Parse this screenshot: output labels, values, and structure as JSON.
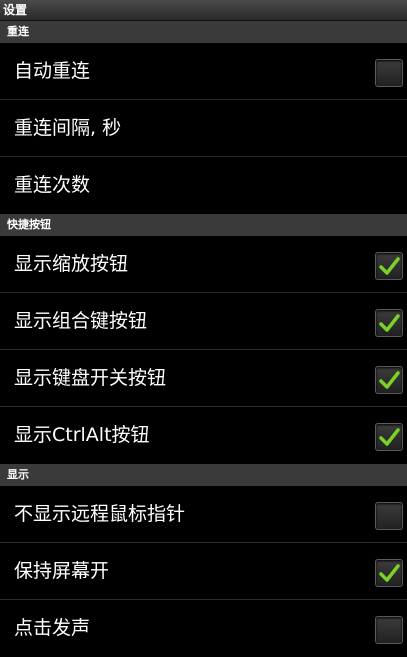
{
  "title": "设置",
  "sections": [
    {
      "header": "重连",
      "items": [
        {
          "label": "自动重连",
          "checkbox": true,
          "checked": false
        },
        {
          "label": "重连间隔, 秒",
          "checkbox": false
        },
        {
          "label": "重连次数",
          "checkbox": false
        }
      ]
    },
    {
      "header": "快捷按钮",
      "items": [
        {
          "label": "显示缩放按钮",
          "checkbox": true,
          "checked": true
        },
        {
          "label": "显示组合键按钮",
          "checkbox": true,
          "checked": true
        },
        {
          "label": "显示键盘开关按钮",
          "checkbox": true,
          "checked": true
        },
        {
          "label": "显示CtrlAlt按钮",
          "checkbox": true,
          "checked": true
        }
      ]
    },
    {
      "header": "显示",
      "items": [
        {
          "label": "不显示远程鼠标指针",
          "checkbox": true,
          "checked": false
        },
        {
          "label": "保持屏幕开",
          "checkbox": true,
          "checked": true
        },
        {
          "label": "点击发声",
          "checkbox": true,
          "checked": false
        }
      ]
    }
  ],
  "colors": {
    "check": "#7bd125"
  }
}
